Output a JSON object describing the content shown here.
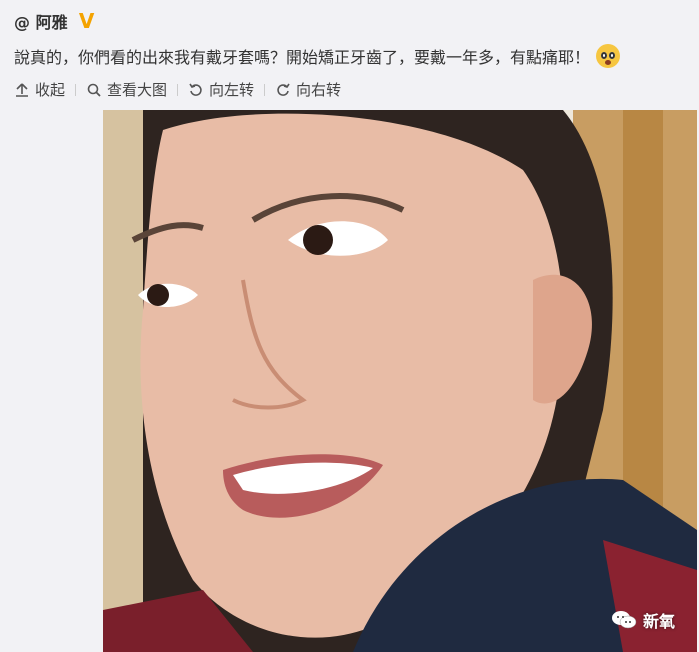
{
  "post": {
    "author": "@ 阿雅",
    "text": "說真的，你們看的出來我有戴牙套嗎？開始矯正牙齒了，要戴一年多，有點痛耶！"
  },
  "toolbar": {
    "collapse_label": "收起",
    "view_large_label": "查看大图",
    "rotate_left_label": "向左转",
    "rotate_right_label": "向右转"
  },
  "watermark": {
    "text": "新氧"
  },
  "colors": {
    "verified": "#f4a300",
    "background": "#f2f2f5"
  }
}
